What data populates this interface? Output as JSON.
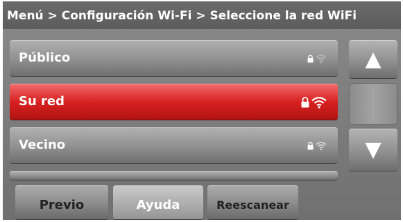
{
  "header": {
    "breadcrumb": "Menú > Configuración Wi-Fi  > Seleccione la red WiFi"
  },
  "networks": [
    {
      "name": "Público",
      "secured": true,
      "signal_icon": "wifi-signal-icon",
      "selected": false
    },
    {
      "name": "Su red",
      "secured": true,
      "signal_icon": "wifi-signal-icon",
      "selected": true
    },
    {
      "name": "Vecino",
      "secured": true,
      "signal_icon": "wifi-signal-icon",
      "selected": false
    }
  ],
  "scroll": {
    "up_icon": "▲",
    "down_icon": "▼"
  },
  "footer": {
    "previo_label": "Previo",
    "ayuda_label": "Ayuda",
    "reescanear_label": "Reescanear"
  },
  "colors": {
    "selected_row": "#d82020",
    "button_gray": "#8a8a8a",
    "header_bg": "#5c5c5c"
  }
}
